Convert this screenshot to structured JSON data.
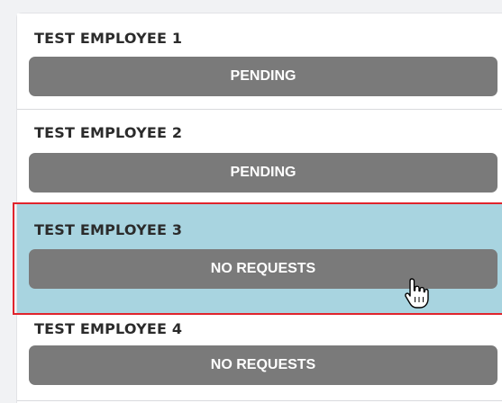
{
  "employees": [
    {
      "name": "TEST EMPLOYEE 1",
      "status": "PENDING"
    },
    {
      "name": "TEST EMPLOYEE 2",
      "status": "PENDING"
    },
    {
      "name": "TEST EMPLOYEE 3",
      "status": "NO REQUESTS"
    },
    {
      "name": "TEST EMPLOYEE 4",
      "status": "NO REQUESTS"
    }
  ],
  "colors": {
    "selected_row": "#a8d4e0",
    "status_button": "#7a7a7a",
    "highlight_border": "#e0242c"
  },
  "cursor": "hand-pointer-icon"
}
